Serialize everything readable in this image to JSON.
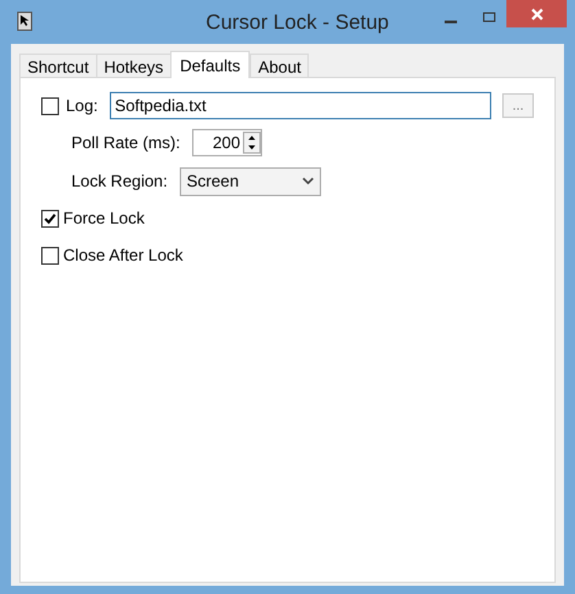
{
  "window": {
    "title": "Cursor Lock - Setup"
  },
  "tabs": [
    {
      "label": "Shortcut",
      "selected": false
    },
    {
      "label": "Hotkeys",
      "selected": false
    },
    {
      "label": "Defaults",
      "selected": true
    },
    {
      "label": "About",
      "selected": false
    }
  ],
  "log": {
    "label": "Log:",
    "checked": false,
    "value": "Softpedia.txt",
    "browse": "..."
  },
  "poll_rate": {
    "label": "Poll Rate (ms):",
    "value": "200"
  },
  "lock_region": {
    "label": "Lock Region:",
    "value": "Screen"
  },
  "options": [
    {
      "label": "Force Lock",
      "checked": true
    },
    {
      "label": "Close After Lock",
      "checked": false
    }
  ]
}
